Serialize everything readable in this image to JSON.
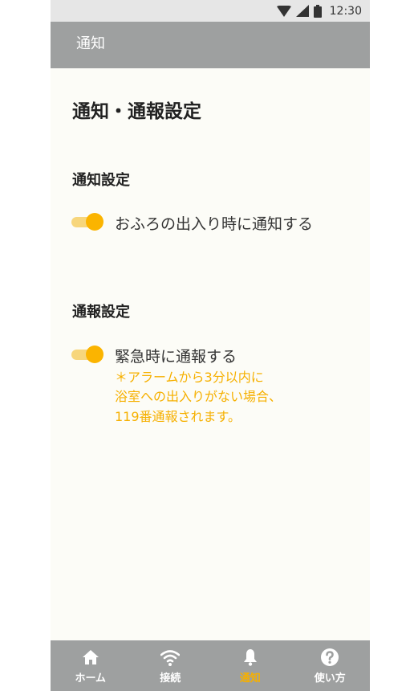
{
  "status_bar": {
    "time": "12:30"
  },
  "app_bar": {
    "title": "通知"
  },
  "page": {
    "title": "通知・通報設定",
    "notification_section": {
      "heading": "通知設定",
      "toggle_label": "おふろの出入り時に通知する",
      "toggle_on": true
    },
    "report_section": {
      "heading": "通報設定",
      "toggle_label": "緊急時に通報する",
      "toggle_on": true,
      "note_lines": [
        "＊アラームから3分以内に",
        "浴室への出入りがない場合、",
        "119番通報されます。"
      ]
    }
  },
  "bottom_nav": {
    "items": [
      {
        "label": "ホーム",
        "icon": "home-icon"
      },
      {
        "label": "接続",
        "icon": "wifi-icon"
      },
      {
        "label": "通知",
        "icon": "bell-icon",
        "active": true
      },
      {
        "label": "使い方",
        "icon": "help-icon"
      }
    ]
  },
  "colors": {
    "accent": "#f6b000",
    "toggle_track": "#f7d67c",
    "bar_gray": "#9ea0a0",
    "background": "#fcfcf7"
  }
}
